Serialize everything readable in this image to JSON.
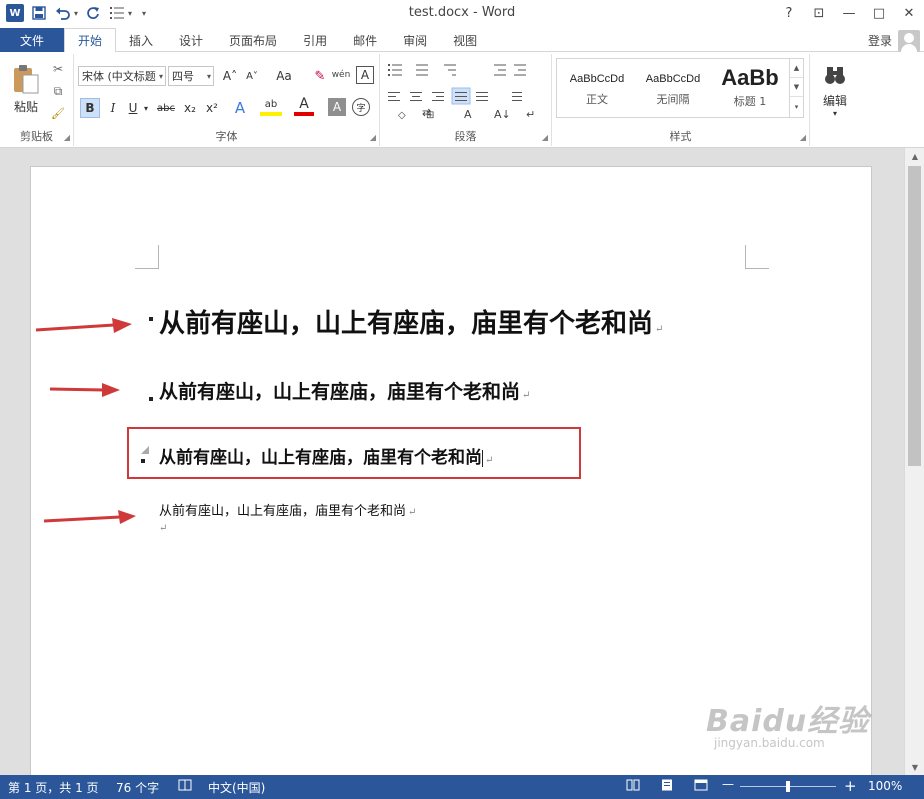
{
  "window": {
    "title": "test.docx - Word",
    "help": "?",
    "ribbon_display": "⊡",
    "minimize": "—",
    "maximize": "□",
    "close": "✕"
  },
  "qat": {
    "logo": "W",
    "save": "💾",
    "undo": "↶",
    "redo": "↻",
    "list": "☰",
    "customize": "▾"
  },
  "tabs": {
    "file": "文件",
    "items": [
      "开始",
      "插入",
      "设计",
      "页面布局",
      "引用",
      "邮件",
      "审阅",
      "视图"
    ],
    "active_index": 0,
    "login": "登录"
  },
  "ribbon": {
    "clipboard": {
      "label": "剪贴板",
      "paste": "粘贴",
      "cut": "✂",
      "copy": "⧉",
      "painter": "🖌"
    },
    "font": {
      "label": "字体",
      "font_name": "宋体 (中文标题",
      "font_size": "四号",
      "grow": "A˄",
      "shrink": "A˅",
      "case": "Aa",
      "clear": "✎",
      "phonetic": "wén",
      "border": "A",
      "bold": "B",
      "italic": "I",
      "underline": "U",
      "strike": "abc",
      "subscript": "x₂",
      "superscript": "x²",
      "effects": "A",
      "highlight": "ab",
      "color": "A",
      "shade": "A",
      "enclose": "字"
    },
    "paragraph": {
      "label": "段落"
    },
    "styles": {
      "label": "样式",
      "items": [
        {
          "preview": "AaBbCcDd",
          "name": "正文"
        },
        {
          "preview": "AaBbCcDd",
          "name": "无间隔"
        },
        {
          "preview": "AaBb",
          "name": "标题 1"
        }
      ]
    },
    "editing": {
      "label": "编辑",
      "icon": "🔭"
    }
  },
  "document": {
    "lines": [
      "从前有座山，山上有座庙，庙里有个老和尚",
      "从前有座山，山上有座庙，庙里有个老和尚",
      "从前有座山，山上有座庙，庙里有个老和尚",
      "从前有座山，山上有座庙，庙里有个老和尚"
    ],
    "paragraph_mark": "↵"
  },
  "status": {
    "page": "第 1 页，共 1 页",
    "words": "76 个字",
    "proofing": "📖",
    "language": "中文(中国)",
    "zoom_out": "—",
    "zoom_in": "+",
    "zoom": "100%"
  },
  "watermark": {
    "logo": "Baidu经验",
    "url": "jingyan.baidu.com"
  },
  "colors": {
    "brand": "#2b579a",
    "annotation": "#d0393a"
  }
}
